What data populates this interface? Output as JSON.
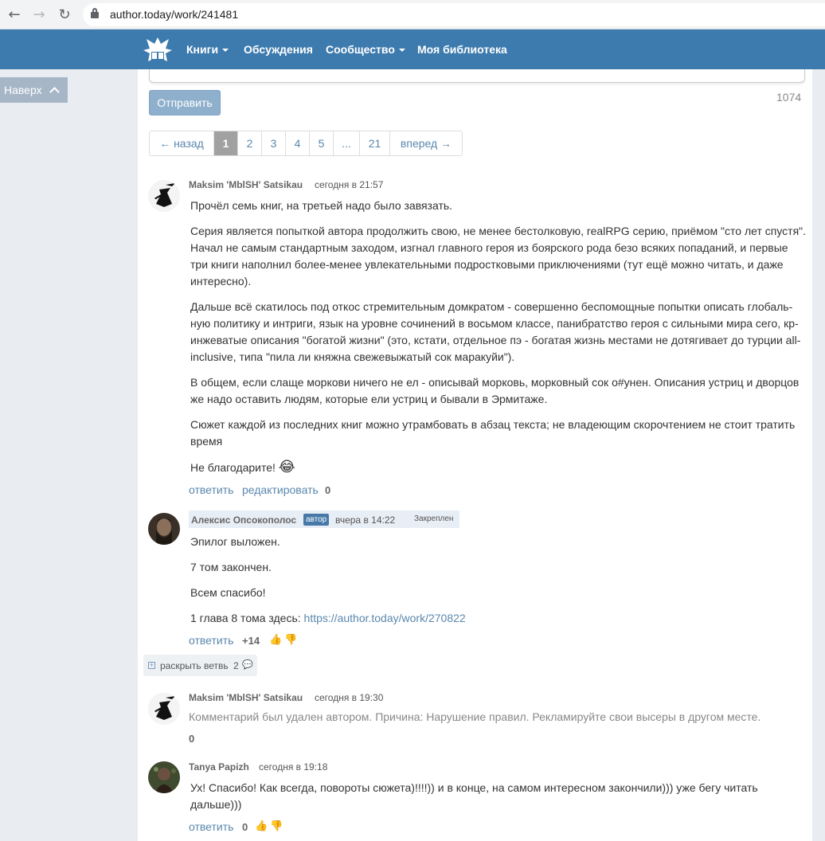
{
  "browser": {
    "url": "author.today/work/241481"
  },
  "nav": {
    "books": "Книги",
    "discussions": "Обсуждения",
    "community": "Сообщество",
    "library": "Моя библиотека"
  },
  "to_top": "Наверх",
  "form": {
    "send_label": "Отправить",
    "char_count": "1074"
  },
  "pagination": {
    "prev": "← назад",
    "pages": [
      "1",
      "2",
      "3",
      "4",
      "5",
      "...",
      "21"
    ],
    "active": "1",
    "next": "вперед →"
  },
  "comments": [
    {
      "author": "Maksim 'MblSH' Satsikau",
      "time": "сегодня в 21:57",
      "paragraphs": [
        "Прочёл семь книг, на третьей надо было завязать.",
        "Серия является попыткой автора продолжить свою, не менее бестолковую, realRPG серию, приёмом \"сто лет спустя\". Начал не самым стандартным заходом, изгнал главного героя из боярского рода безо всяких попаданий, и первые три книги наполнил более-менее увлекательными подростковыми приключениями (тут ещё можно читать, и даже интересно).",
        "Дальше всё скатилось под откос стремительным домкратом - совершенно беспомощные попытки описать глобаль-ную политику и интриги, язык на уровне сочинений в восьмом классе, панибратство героя с сильными мира сего, кр-инжеватые описания \"богатой жизни\" (это, кстати, отдельное пэ - богатая жизнь местами не дотягивает до турции all-inclusive, типа \"пила ли княжна свежевыжатый сок маракуйи\").",
        "В общем, если слаще моркови ничего не ел - описывай морковь, морковный сок о#унен. Описания устриц и дворцов же надо оставить людям, которые ели устриц и бывали в Эрмитаже.",
        "Сюжет каждой из последних книг можно утрамбовать в абзац текста; не владеющим скорочтением не стоит тратить время",
        "Не благодарите!"
      ],
      "emoji": "😂",
      "reply": "ответить",
      "edit": "редактировать",
      "score": "0"
    },
    {
      "author": "Алексис Опсокополос",
      "badge": "автор",
      "time": "вчера в 14:22",
      "pinned": "Закреплен",
      "paragraphs": [
        "Эпилог выложен.",
        "7 том закончен.",
        "Всем спасибо!"
      ],
      "link_prefix": "1 глава 8 тома здесь: ",
      "link": "https://author.today/work/270822",
      "reply": "ответить",
      "score": "+14"
    },
    {
      "branch_label": "раскрыть ветвь",
      "branch_count": "2"
    },
    {
      "author": "Maksim 'MblSH' Satsikau",
      "time": "сегодня в 19:30",
      "deleted_text": "Комментарий был удален автором. Причина: Нарушение правил. Рекламируйте свои высеры в другом месте.",
      "score": "0"
    },
    {
      "author": "Tanya Papizh",
      "time": "сегодня в 19:18",
      "text": "Ух! Спасибо! Как всегда, повороты сюжета)!!!!)) и в конце, на самом интересном закончили))) уже бегу читать дальше)))",
      "reply": "ответить",
      "score": "0"
    }
  ]
}
